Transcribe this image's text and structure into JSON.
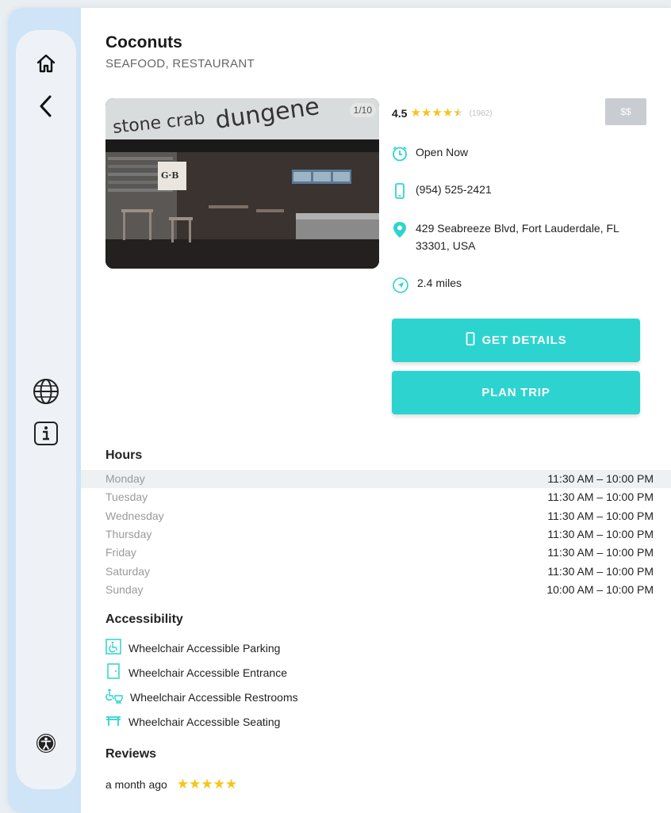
{
  "restaurant": {
    "name": "Coconuts",
    "category": "SEAFOOD, RESTAURANT",
    "photo_counter": "1/10",
    "rating": "4.5",
    "rating_stars": 4.5,
    "review_count": "(1962)",
    "price": "$$",
    "status": "Open Now",
    "phone": "(954) 525-2421",
    "address_line1": "429 Seabreeze Blvd, Fort Lauderdale, FL",
    "address_line2": "33301, USA",
    "distance": "2.4 miles"
  },
  "photo": {
    "sign_text_1": "stone crab",
    "sign_text_2": "dungene",
    "logo_text": "G·B"
  },
  "buttons": {
    "get_details": "GET DETAILS",
    "plan_trip": "PLAN TRIP"
  },
  "sections": {
    "hours": "Hours",
    "accessibility": "Accessibility",
    "reviews": "Reviews"
  },
  "hours": [
    {
      "day": "Monday",
      "time": "11:30 AM – 10:00 PM"
    },
    {
      "day": "Tuesday",
      "time": "11:30 AM – 10:00 PM"
    },
    {
      "day": "Wednesday",
      "time": "11:30 AM – 10:00 PM"
    },
    {
      "day": "Thursday",
      "time": "11:30 AM – 10:00 PM"
    },
    {
      "day": "Friday",
      "time": "11:30 AM – 10:00 PM"
    },
    {
      "day": "Saturday",
      "time": "11:30 AM – 10:00 PM"
    },
    {
      "day": "Sunday",
      "time": "10:00 AM – 10:00 PM"
    }
  ],
  "accessibility": [
    {
      "label": "Wheelchair Accessible Parking",
      "icon": "parking-icon"
    },
    {
      "label": "Wheelchair Accessible Entrance",
      "icon": "door-icon"
    },
    {
      "label": "Wheelchair Accessible Restrooms",
      "icon": "restroom-icon"
    },
    {
      "label": "Wheelchair Accessible Seating",
      "icon": "table-icon"
    }
  ],
  "review": {
    "time_ago": "a month ago",
    "stars": 5
  },
  "sidebar": {
    "icons": [
      "home-icon",
      "back-icon",
      "globe-icon",
      "info-icon",
      "accessibility-icon"
    ]
  },
  "colors": {
    "accent": "#2dd4cf",
    "star": "#f5c518",
    "sidebar": "#cfe4f6"
  }
}
